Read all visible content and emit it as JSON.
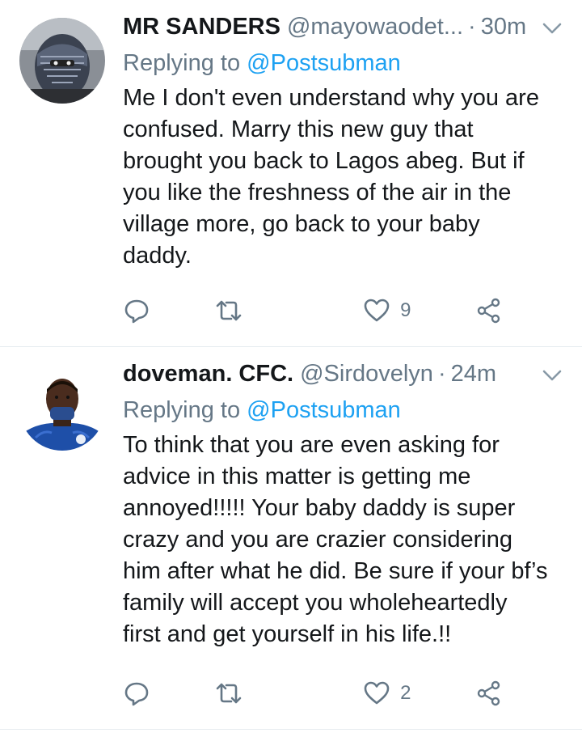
{
  "tweets": [
    {
      "display_name": "MR SANDERS",
      "handle": "@mayowaodet...",
      "separator": "·",
      "time": "30m",
      "replying_prefix": "Replying to",
      "replying_to": "@Postsubman",
      "text_lines": [
        "Me I don't even understand why you are",
        "confused. Marry this new guy that",
        "brought you back to Lagos abeg. But if",
        "you like the freshness of the air in the",
        "village more, go back to your baby",
        "daddy."
      ],
      "likes": "9",
      "icons": [
        "reply-icon",
        "retweet-icon",
        "like-icon",
        "share-icon"
      ]
    },
    {
      "display_name": "doveman. CFC.",
      "handle": "@Sirdovelyn",
      "separator": "·",
      "time": "24m",
      "replying_prefix": "Replying to",
      "replying_to": "@Postsubman",
      "text_lines": [
        "To think that you are even asking for",
        "advice in this matter is getting me",
        "annoyed!!!!! Your baby daddy is super",
        "crazy and you are crazier considering",
        "him after what he did. Be sure if your bf’s",
        "family will accept you wholeheartedly",
        "first and get yourself in his life.!!"
      ],
      "likes": "2",
      "icons": [
        "reply-icon",
        "retweet-icon",
        "like-icon",
        "share-icon"
      ]
    }
  ],
  "colors": {
    "text": "#14171a",
    "secondary": "#657786",
    "link": "#1da1f2",
    "divider": "#e6ecf0"
  }
}
